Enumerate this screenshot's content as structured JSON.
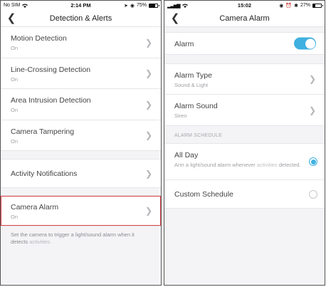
{
  "colors": {
    "accent": "#3fb0e0",
    "highlight": "#e0424a"
  },
  "left": {
    "status": {
      "carrier": "No SIM",
      "time": "2:14 PM",
      "battery": "75%",
      "battery_level": 0.75
    },
    "nav": {
      "title": "Detection & Alerts",
      "back_icon": "chevron-left-icon"
    },
    "rows": [
      {
        "label": "Motion Detection",
        "sub": "On"
      },
      {
        "label": "Line-Crossing Detection",
        "sub": "On"
      },
      {
        "label": "Area Intrusion Detection",
        "sub": "On"
      },
      {
        "label": "Camera Tampering",
        "sub": "On"
      }
    ],
    "activity_notifications": {
      "label": "Activity Notifications"
    },
    "camera_alarm": {
      "label": "Camera Alarm",
      "sub": "On"
    },
    "footnote": {
      "text": "Set the camera to trigger a light/sound alarm when it detects",
      "muted": "activities."
    }
  },
  "right": {
    "status": {
      "time": "15:02",
      "battery": "27%",
      "battery_level": 0.27
    },
    "nav": {
      "title": "Camera Alarm",
      "back_icon": "chevron-left-icon"
    },
    "alarm": {
      "label": "Alarm",
      "enabled": true
    },
    "alarm_type": {
      "label": "Alarm Type",
      "sub": "Sound & Light"
    },
    "alarm_sound": {
      "label": "Alarm Sound",
      "sub": "Siren"
    },
    "schedule_header": "ALARM SCHEDULE",
    "all_day": {
      "label": "All Day",
      "desc": "Arm a light/sound alarm whenever",
      "desc_muted": "activities",
      "desc_end": "detected.",
      "selected": true
    },
    "custom_schedule": {
      "label": "Custom Schedule",
      "selected": false
    }
  }
}
